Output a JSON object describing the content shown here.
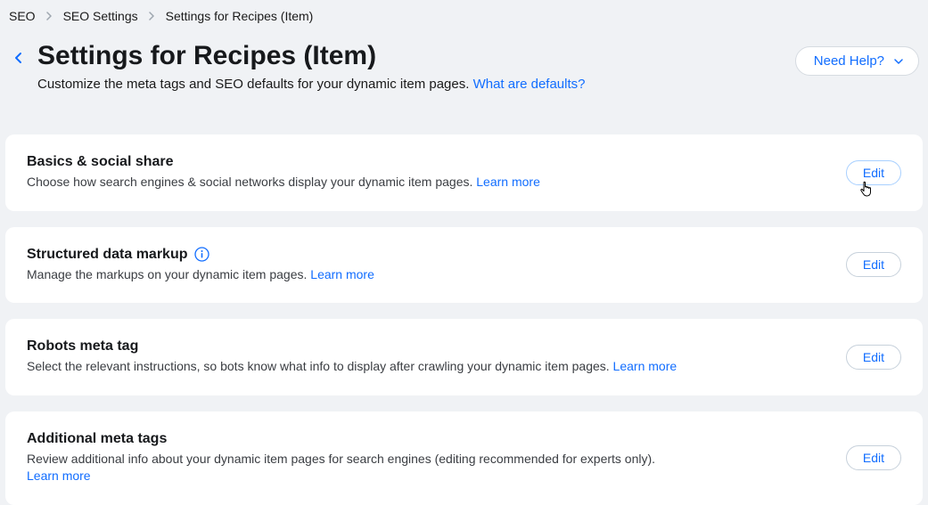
{
  "breadcrumb": {
    "items": [
      "SEO",
      "SEO Settings",
      "Settings for Recipes (Item)"
    ]
  },
  "header": {
    "title": "Settings for Recipes (Item)",
    "subtitle_prefix": "Customize the meta tags and SEO defaults for your dynamic item pages. ",
    "subtitle_link": "What are defaults?",
    "need_help": "Need Help?"
  },
  "cards": [
    {
      "title": "Basics & social share",
      "desc_prefix": "Choose how search engines & social networks display your dynamic item pages. ",
      "learn_more": "Learn more",
      "edit": "Edit",
      "info": false,
      "hovered": true
    },
    {
      "title": "Structured data markup",
      "desc_prefix": "Manage the markups on your dynamic item pages. ",
      "learn_more": "Learn more",
      "edit": "Edit",
      "info": true,
      "hovered": false
    },
    {
      "title": "Robots meta tag",
      "desc_prefix": "Select the relevant instructions, so bots know what info to display after crawling your dynamic item pages. ",
      "learn_more": "Learn more",
      "edit": "Edit",
      "info": false,
      "hovered": false
    },
    {
      "title": "Additional meta tags",
      "desc_prefix": "Review additional info about your dynamic item pages for search engines (editing recommended for experts only). ",
      "learn_more": "Learn more",
      "edit": "Edit",
      "info": false,
      "hovered": false,
      "break_before_learn": true
    }
  ]
}
